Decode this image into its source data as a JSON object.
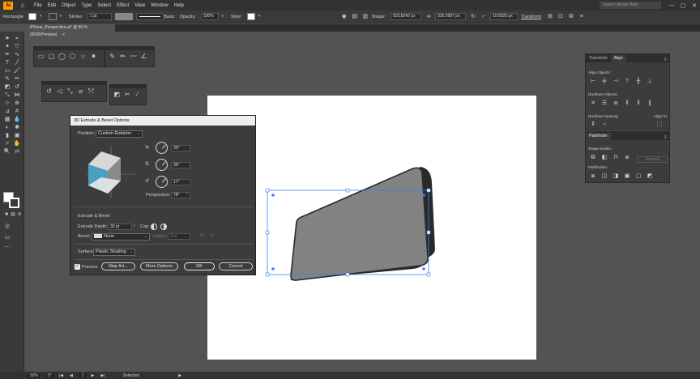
{
  "menubar": {
    "app_badge": "Ai",
    "items": [
      "File",
      "Edit",
      "Object",
      "Type",
      "Select",
      "Effect",
      "View",
      "Window",
      "Help"
    ],
    "search_placeholder": "Search Adobe Help",
    "window_controls": [
      "—",
      "▢",
      "✕"
    ]
  },
  "controlbar": {
    "selection_label": "Rectangle",
    "stroke_label": "Stroke:",
    "stroke_weight": "1 pt",
    "brush_label": "Basic",
    "opacity_label": "Opacity:",
    "opacity_value": "100%",
    "style_label": "Style:",
    "shape_label": "Shape:",
    "width_value": "623.8242 px",
    "height_value": "326.0587 px",
    "angle_value": "19.5925 px",
    "transform_label": "Transform"
  },
  "document": {
    "tab_title": "iPhone_Perspective.ai* @ 50 % (RGB/Preview)",
    "close_glyph": "✕"
  },
  "dialog": {
    "title": "3D Extrude & Bevel Options",
    "position_label": "Position:",
    "position_value": "Custom Rotation",
    "rot_x": "30°",
    "rot_y": "35°",
    "rot_z": "17°",
    "perspective_label": "Perspective:",
    "perspective_value": "78°",
    "section_label": "Extrude & Bevel",
    "extrude_depth_label": "Extrude Depth:",
    "extrude_depth_value": "30 pt",
    "cap_label": "Cap:",
    "bevel_label": "Bevel:",
    "bevel_value": "None",
    "height_label": "Height:",
    "height_value": "4 pt",
    "surface_label": "Surface:",
    "surface_value": "Plastic Shading",
    "preview_label": "Preview",
    "map_art_label": "Map Art...",
    "more_options_label": "More Options",
    "ok_label": "OK",
    "cancel_label": "Cancel"
  },
  "align_panel": {
    "tabs": [
      "Transform",
      "Align"
    ],
    "align_objects_label": "Align Objects:",
    "distribute_objects_label": "Distribute Objects:",
    "distribute_spacing_label": "Distribute Spacing:",
    "align_to_label": "Align To:"
  },
  "pathfinder_panel": {
    "tab": "Pathfinder",
    "shape_modes_label": "Shape Modes:",
    "pathfinders_label": "Pathfinders:",
    "expand_label": "Expand"
  },
  "statusbar": {
    "zoom": "50%",
    "rotation": "0°",
    "artboard_number": "1",
    "mode": "Selection"
  },
  "colors": {
    "ui_bg": "#535353",
    "panel": "#3c3c3c",
    "cube_front": "#4aa0c0",
    "phone_fill": "#828282",
    "phone_side": "#2a2a2a",
    "selection_blue": "#3d7ff0"
  }
}
